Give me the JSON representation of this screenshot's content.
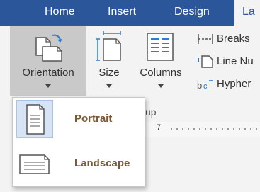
{
  "tabs": {
    "home": "Home",
    "insert": "Insert",
    "design": "Design",
    "layout": "La"
  },
  "page_setup": {
    "orientation_label": "Orientation",
    "size_label": "Size",
    "columns_label": "Columns",
    "breaks_label": "Breaks",
    "line_numbers_label": "Line Nu",
    "hyphenation_label": "Hypher",
    "group_label": "up"
  },
  "ruler": {
    "number": "7"
  },
  "orientation_menu": {
    "items": [
      {
        "label": "Portrait",
        "selected": true
      },
      {
        "label": "Landscape",
        "selected": false
      }
    ]
  },
  "colors": {
    "tab_bar": "#2b579a",
    "ribbon": "#f3f3f3",
    "selected_button": "#c9c9c9",
    "icon_accent": "#2b7cd3",
    "menu_text": "#7a5a35",
    "selected_item": "#d6e4f5"
  }
}
